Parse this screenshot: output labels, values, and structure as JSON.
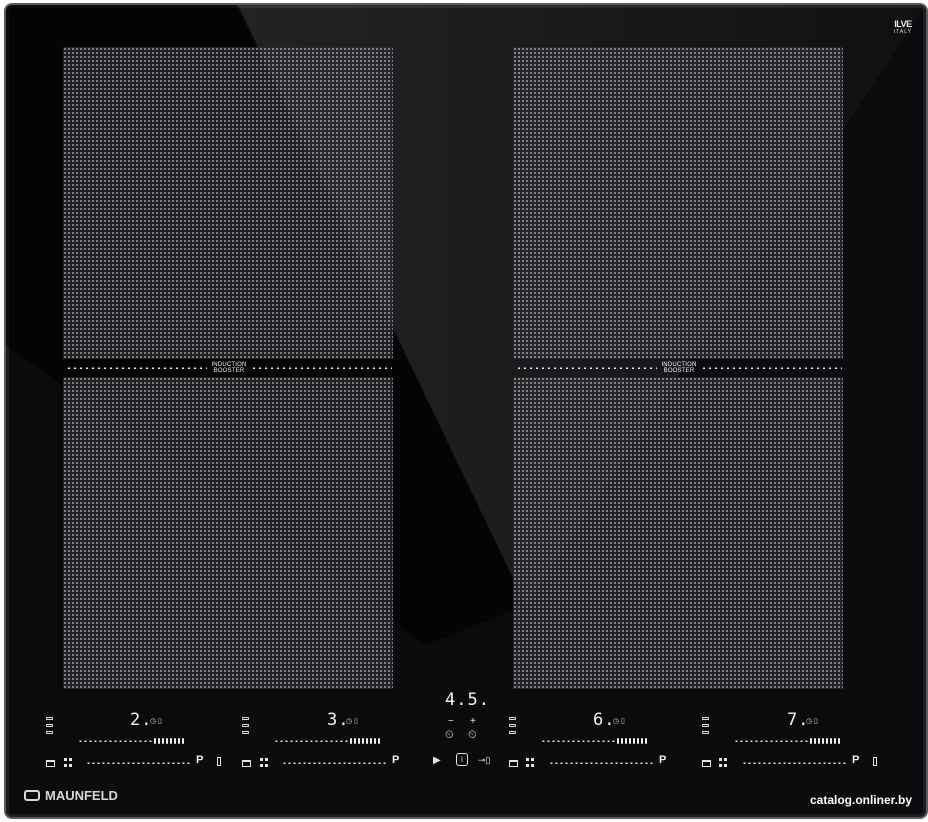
{
  "brand": {
    "name": "MAUNFELD"
  },
  "top_logo": {
    "mark": "ILVE",
    "sub": "ITALY"
  },
  "watermark": "catalog.onliner.by",
  "booster_left": {
    "line1": "INDUCTION",
    "line2": "BOOSTER"
  },
  "booster_right": {
    "line1": "INDUCTION",
    "line2": "BOOSTER"
  },
  "zones": [
    {
      "level": "2.",
      "label": "P"
    },
    {
      "level": "3.",
      "label": "P"
    },
    {
      "level": "6.",
      "label": "P"
    },
    {
      "level": "7.",
      "label": "P"
    }
  ],
  "timer": {
    "display": "4.5.",
    "minus": "−",
    "plus": "+"
  },
  "icons": {
    "play": "play-icon",
    "power": "power-icon",
    "key": "key-icon",
    "clock": "clock-icon",
    "pot": "pot-icon",
    "grid": "bridge-grid-icon",
    "lock": "lock-icon"
  },
  "colors": {
    "glass": "#0b0b0d",
    "frame": "#5a5c62",
    "print": "#f0f0f2"
  }
}
